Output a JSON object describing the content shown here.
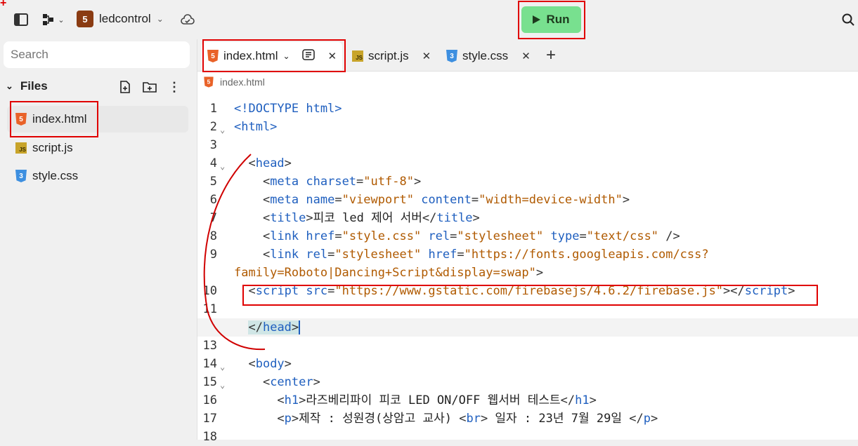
{
  "topbar": {
    "repl_name": "ledcontrol",
    "run_label": "Run"
  },
  "sidebar": {
    "search_placeholder": "Search",
    "files_title": "Files",
    "files": [
      {
        "name": "index.html",
        "type": "html",
        "active": true
      },
      {
        "name": "script.js",
        "type": "js",
        "active": false
      },
      {
        "name": "style.css",
        "type": "css",
        "active": false
      }
    ]
  },
  "editor": {
    "tabs": [
      {
        "label": "index.html",
        "active": true
      },
      {
        "label": "script.js",
        "active": false
      },
      {
        "label": "style.css",
        "active": false
      }
    ],
    "breadcrumb": "index.html",
    "active_line": 12,
    "lines": [
      {
        "n": "1",
        "fold": false
      },
      {
        "n": "2",
        "fold": true
      },
      {
        "n": "3",
        "fold": false
      },
      {
        "n": "4",
        "fold": true
      },
      {
        "n": "5",
        "fold": false
      },
      {
        "n": "6",
        "fold": false
      },
      {
        "n": "7",
        "fold": false
      },
      {
        "n": "8",
        "fold": false
      },
      {
        "n": "9",
        "fold": false
      },
      {
        "n": "",
        "fold": false
      },
      {
        "n": "10",
        "fold": false
      },
      {
        "n": "11",
        "fold": false
      },
      {
        "n": "12",
        "fold": false
      },
      {
        "n": "13",
        "fold": false
      },
      {
        "n": "14",
        "fold": true
      },
      {
        "n": "15",
        "fold": true
      },
      {
        "n": "16",
        "fold": false
      },
      {
        "n": "17",
        "fold": false
      },
      {
        "n": "18",
        "fold": false
      }
    ],
    "code": {
      "l1": "<!DOCTYPE html>",
      "l2": "<html>",
      "l5_charset": "\"utf-8\"",
      "l6_name": "\"viewport\"",
      "l6_content": "\"width=device-width\"",
      "l7_title": "피코 led 제어 서버",
      "l8_href": "\"style.css\"",
      "l8_rel": "\"stylesheet\"",
      "l8_type": "\"text/css\"",
      "l9_rel": "\"stylesheet\"",
      "l9_href_a": "\"https://fonts.googleapis.com/css?",
      "l9_href_b": "family=Roboto|Dancing+Script&display=swap\"",
      "l10_src": "\"https://www.gstatic.com/firebasejs/4.6.2/firebase.js\"",
      "l16_h1": "라즈베리파이 피코 LED ON/OFF 웹서버 테스트",
      "l17_p_a": "제작 : 성원경(상암고 교사) ",
      "l17_p_b": " 일자 : 23년 7월 29일 "
    }
  }
}
